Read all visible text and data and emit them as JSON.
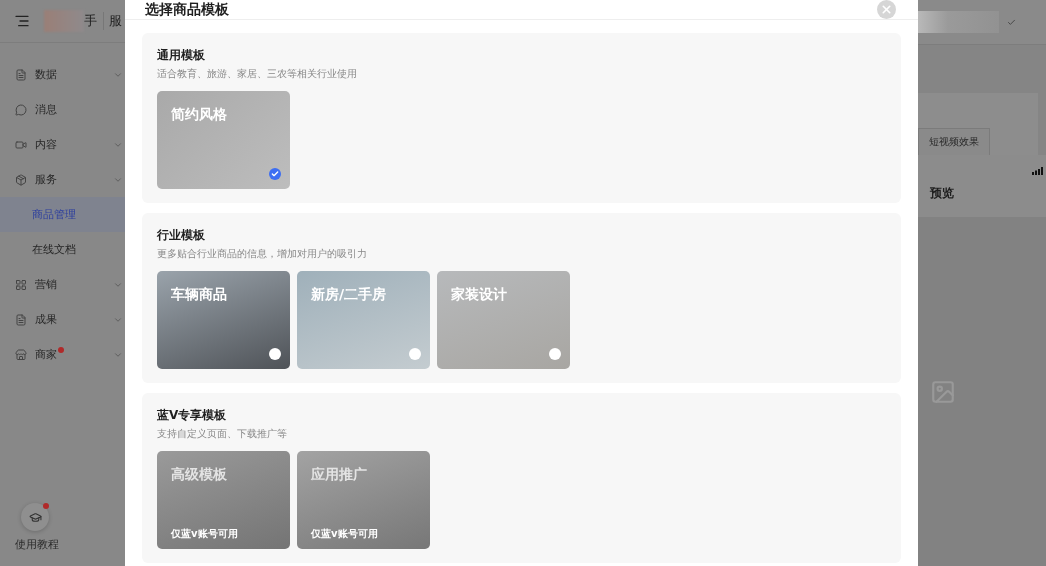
{
  "app_header": {
    "brand": "手",
    "breadcrumb": "服"
  },
  "sidebar": {
    "items": [
      {
        "kind": "menu",
        "label": "数据",
        "selected": false,
        "dot": false
      },
      {
        "kind": "menu",
        "label": "消息",
        "selected": false,
        "dot": false
      },
      {
        "kind": "menu",
        "label": "内容",
        "selected": false,
        "dot": false
      },
      {
        "kind": "menu",
        "label": "服务",
        "selected": false,
        "dot": false
      },
      {
        "kind": "sub",
        "label": "商品管理",
        "selected": true,
        "dot": false
      },
      {
        "kind": "sub",
        "label": "在线文档",
        "selected": false,
        "dot": false
      },
      {
        "kind": "menu",
        "label": "营销",
        "selected": false,
        "dot": false
      },
      {
        "kind": "menu",
        "label": "成果",
        "selected": false,
        "dot": false
      },
      {
        "kind": "menu",
        "label": "商家",
        "selected": false,
        "dot": true
      }
    ],
    "help": {
      "label": "使用教程",
      "dot": true
    }
  },
  "preview_panel": {
    "tab": "短视频效果",
    "title": "预览"
  },
  "dialog": {
    "title": "选择商品模板",
    "sections": [
      {
        "title": "通用模板",
        "description": "适合教育、旅游、家居、三农等相关行业使用",
        "cards": [
          {
            "title": "简约风格",
            "selected": true,
            "disabled": false
          }
        ]
      },
      {
        "title": "行业模板",
        "description": "更多贴合行业商品的信息，增加对用户的吸引力",
        "cards": [
          {
            "title": "车辆商品",
            "selected": false,
            "disabled": false
          },
          {
            "title": "新房/二手房",
            "selected": false,
            "disabled": false
          },
          {
            "title": "家装设计",
            "selected": false,
            "disabled": false
          }
        ]
      },
      {
        "title": "蓝V专享模板",
        "description": "支持自定义页面、下载推广等",
        "cards": [
          {
            "title": "高级模板",
            "selected": false,
            "disabled": true,
            "note": "仅蓝v账号可用"
          },
          {
            "title": "应用推广",
            "selected": false,
            "disabled": true,
            "note": "仅蓝v账号可用"
          }
        ]
      }
    ]
  }
}
